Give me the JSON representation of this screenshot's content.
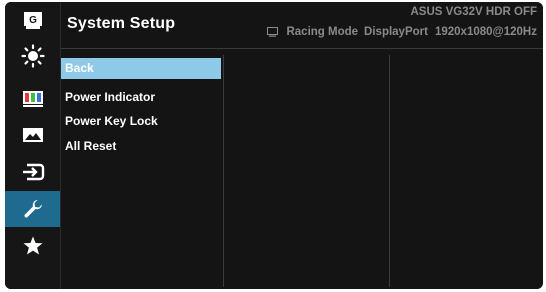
{
  "header": {
    "title": "System Setup",
    "model": "ASUS VG32V HDR OFF",
    "status": {
      "mode": "Racing Mode",
      "input": "DisplayPort",
      "resolution": "1920x1080@120Hz"
    }
  },
  "sidebar": {
    "items": [
      {
        "icon": "gameplus-icon",
        "active": false
      },
      {
        "icon": "brightness-icon",
        "active": false
      },
      {
        "icon": "color-icon",
        "active": false
      },
      {
        "icon": "image-icon",
        "active": false
      },
      {
        "icon": "input-select-icon",
        "active": false
      },
      {
        "icon": "wrench-icon",
        "active": true
      },
      {
        "icon": "star-icon",
        "active": false
      }
    ]
  },
  "menu": {
    "items": [
      {
        "label": "Back",
        "selected": true
      },
      {
        "label": "Power Indicator",
        "selected": false
      },
      {
        "label": "Power Key Lock",
        "selected": false
      },
      {
        "label": "All Reset",
        "selected": false
      }
    ]
  },
  "colors": {
    "background": "#141414",
    "active_tab": "#1f6b8f",
    "selection": "#8fc9e8",
    "muted_text": "#8a8a8a"
  }
}
